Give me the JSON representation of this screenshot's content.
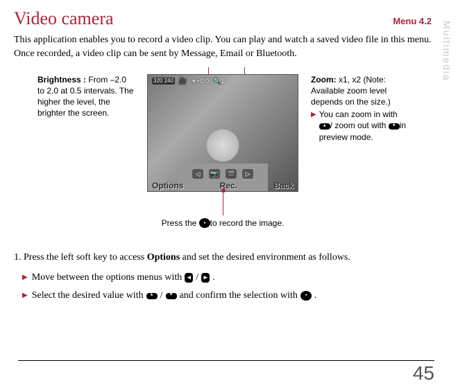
{
  "side_tab": "Multimedia",
  "header": {
    "title": "Video camera",
    "menu": "Menu 4.2"
  },
  "intro": "This application enables you to record a video clip. You can play and watch a saved video file in this menu. Once recorded, a video clip can be sent by Message, Email or Bluetooth.",
  "brightness": {
    "label": "Brightness :",
    "text": " From –2.0 to 2.0 at 0.5 intervals. The higher the level, the brighter the screen."
  },
  "zoom": {
    "label": "Zoom:",
    "text": " x1, x2 (Note: Available zoom level depends on the size.)",
    "sub1": "You can zoom in with",
    "sub2a": "/ zoom out with",
    "sub2b": "in preview mode."
  },
  "osd": {
    "res": "320\n240",
    "exp": "+0.0",
    "zoom_ind": "1"
  },
  "softkeys": {
    "left": "Options",
    "center": "Rec.",
    "right": "Back"
  },
  "press_hint_a": "Press the ",
  "press_hint_b": "to record the image.",
  "steps": {
    "line1a": "1. Press the left soft key to access ",
    "line1b": "Options",
    "line1c": " and set the desired environment as follows.",
    "bullet1a": "Move between the options menus with ",
    "bullet1b": " / ",
    "bullet1c": ".",
    "bullet2a": "Select the desired value with ",
    "bullet2b": " / ",
    "bullet2c": " and confirm the selection with ",
    "bullet2d": "."
  },
  "page_number": "45"
}
